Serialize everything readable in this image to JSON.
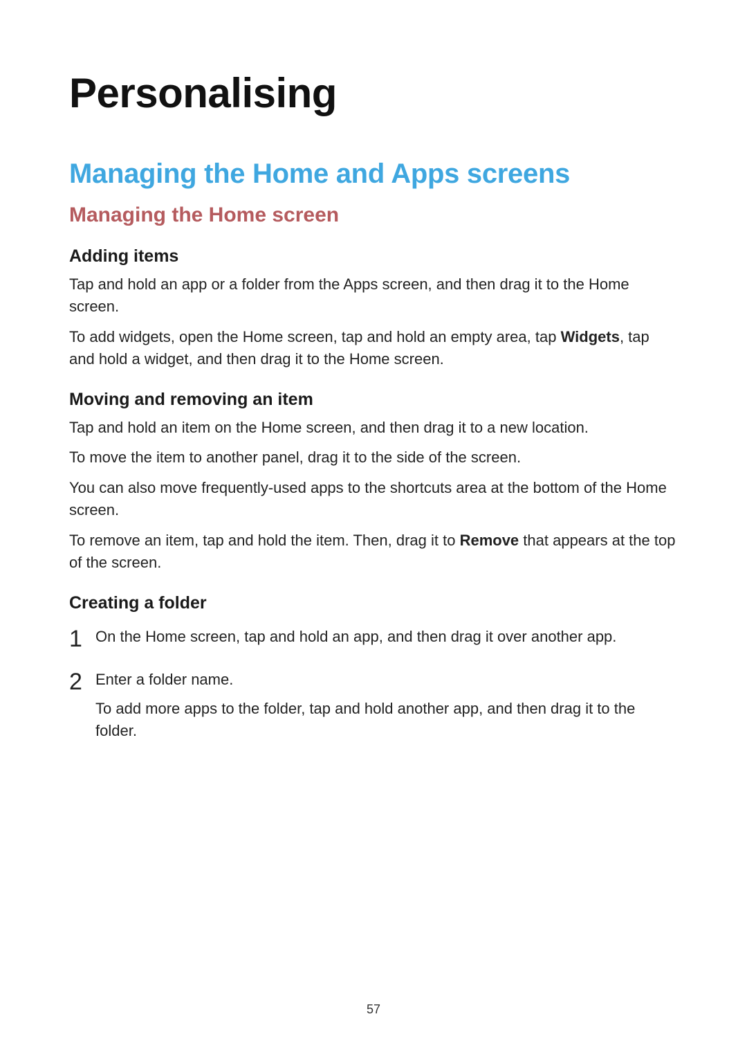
{
  "page_number": "57",
  "h1": "Personalising",
  "h2": "Managing the Home and Apps screens",
  "h3": "Managing the Home screen",
  "section_adding": {
    "title": "Adding items",
    "p1": "Tap and hold an app or a folder from the Apps screen, and then drag it to the Home screen.",
    "p2_pre": "To add widgets, open the Home screen, tap and hold an empty area, tap ",
    "p2_bold": "Widgets",
    "p2_post": ", tap and hold a widget, and then drag it to the Home screen."
  },
  "section_moving": {
    "title": "Moving and removing an item",
    "p1": "Tap and hold an item on the Home screen, and then drag it to a new location.",
    "p2": "To move the item to another panel, drag it to the side of the screen.",
    "p3": "You can also move frequently-used apps to the shortcuts area at the bottom of the Home screen.",
    "p4_pre": "To remove an item, tap and hold the item. Then, drag it to ",
    "p4_bold": "Remove",
    "p4_post": " that appears at the top of the screen."
  },
  "section_folder": {
    "title": "Creating a folder",
    "steps": [
      {
        "num": "1",
        "lines": [
          "On the Home screen, tap and hold an app, and then drag it over another app."
        ]
      },
      {
        "num": "2",
        "lines": [
          "Enter a folder name.",
          "To add more apps to the folder, tap and hold another app, and then drag it to the folder."
        ]
      }
    ]
  }
}
